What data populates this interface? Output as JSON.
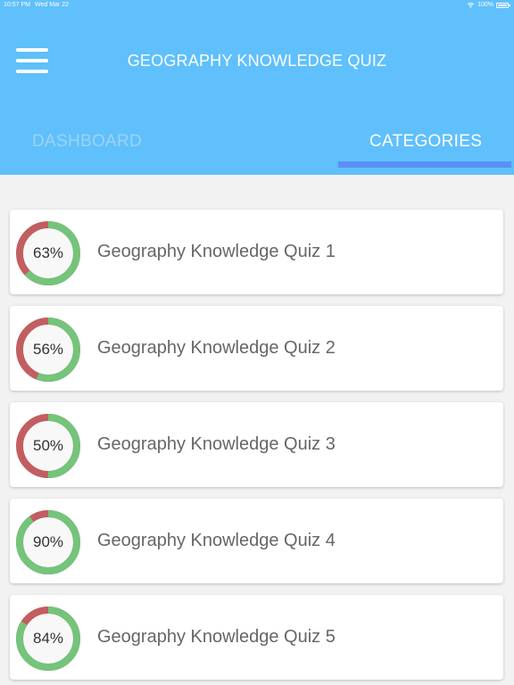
{
  "status_bar": {
    "time": "10:57 PM",
    "date": "Wed Mar 22",
    "battery": "100%",
    "battery_level": 1.0
  },
  "header": {
    "menu_icon": "hamburger-menu-icon",
    "title": "GEOGRAPHY KNOWLEDGE QUIZ"
  },
  "tabs": [
    {
      "label": "DASHBOARD",
      "active": false
    },
    {
      "label": "CATEGORIES",
      "active": true
    }
  ],
  "colors": {
    "header": "#5fc0fc",
    "tab_indicator": "#5b8ff5",
    "ring_correct": "#74c47b",
    "ring_wrong": "#c25e60"
  },
  "quizzes": [
    {
      "title": "Geography Knowledge Quiz 1",
      "score_label": "63%",
      "score": 63
    },
    {
      "title": "Geography Knowledge Quiz 2",
      "score_label": "56%",
      "score": 56
    },
    {
      "title": "Geography Knowledge Quiz 3",
      "score_label": "50%",
      "score": 50
    },
    {
      "title": "Geography Knowledge Quiz 4",
      "score_label": "90%",
      "score": 90
    },
    {
      "title": "Geography Knowledge Quiz 5",
      "score_label": "84%",
      "score": 84
    }
  ]
}
